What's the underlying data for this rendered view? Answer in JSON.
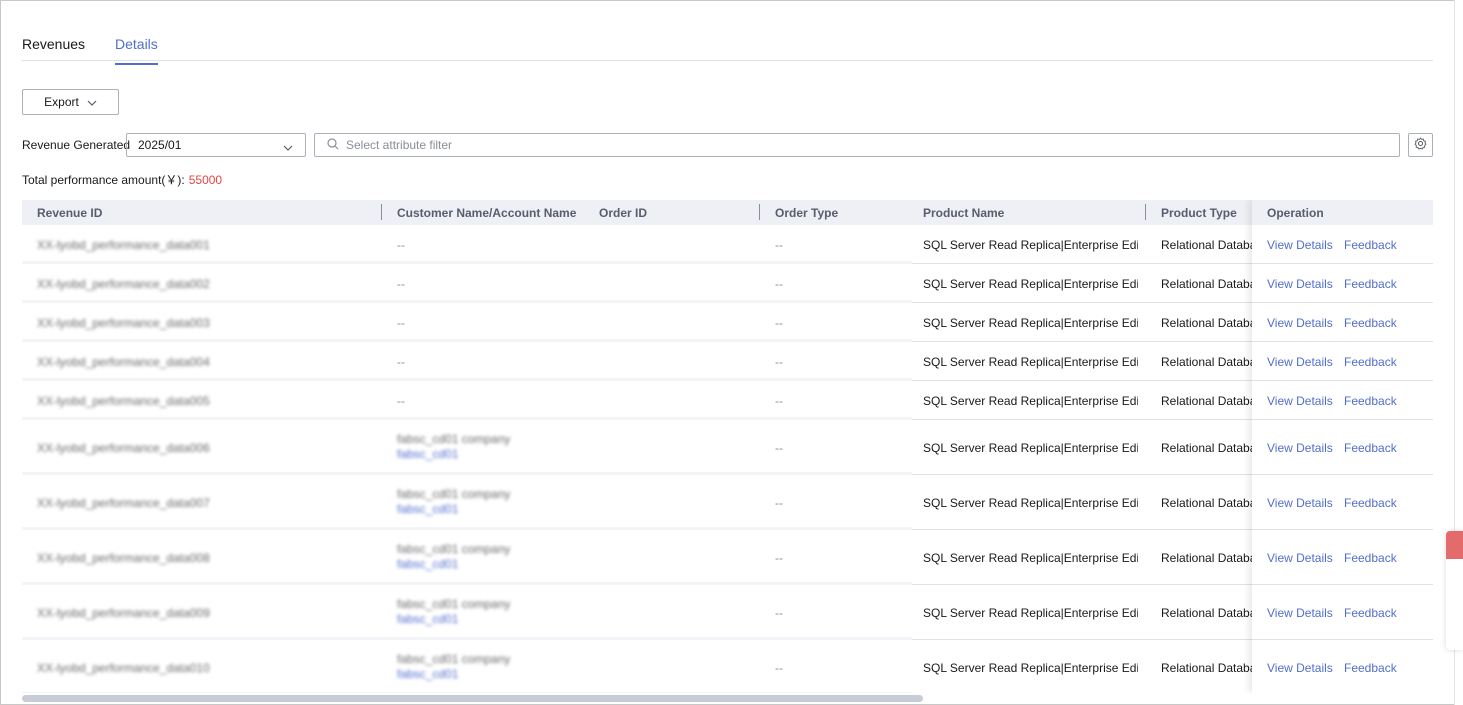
{
  "tabs": [
    {
      "label": "Revenues",
      "active": false
    },
    {
      "label": "Details",
      "active": true
    }
  ],
  "toolbar": {
    "export_label": "Export"
  },
  "filters": {
    "revenue_generated_label": "Revenue Generated",
    "month_value": "2025/01",
    "attribute_placeholder": "Select attribute filter"
  },
  "total": {
    "label": "Total performance amount(￥):",
    "amount": "55000"
  },
  "table": {
    "columns": [
      "Revenue ID",
      "Customer Name/Account Name",
      "Order ID",
      "Order Type",
      "Product Name",
      "Product Type",
      "Operation"
    ],
    "rows": [
      {
        "revenue_id": "XX-lyobd_performance_data001",
        "customer": "--",
        "account": "",
        "order_id": "",
        "order_type": "--",
        "product_name": "SQL Server Read Replica|Enterprise Edit...",
        "product_type": "Relational Databas",
        "view": "View Details",
        "feedback": "Feedback"
      },
      {
        "revenue_id": "XX-lyobd_performance_data002",
        "customer": "--",
        "account": "",
        "order_id": "",
        "order_type": "--",
        "product_name": "SQL Server Read Replica|Enterprise Edit...",
        "product_type": "Relational Databas",
        "view": "View Details",
        "feedback": "Feedback"
      },
      {
        "revenue_id": "XX-lyobd_performance_data003",
        "customer": "--",
        "account": "",
        "order_id": "",
        "order_type": "--",
        "product_name": "SQL Server Read Replica|Enterprise Edit...",
        "product_type": "Relational Databas",
        "view": "View Details",
        "feedback": "Feedback"
      },
      {
        "revenue_id": "XX-lyobd_performance_data004",
        "customer": "--",
        "account": "",
        "order_id": "",
        "order_type": "--",
        "product_name": "SQL Server Read Replica|Enterprise Edit...",
        "product_type": "Relational Databas",
        "view": "View Details",
        "feedback": "Feedback"
      },
      {
        "revenue_id": "XX-lyobd_performance_data005",
        "customer": "--",
        "account": "",
        "order_id": "",
        "order_type": "--",
        "product_name": "SQL Server Read Replica|Enterprise Edit...",
        "product_type": "Relational Databas",
        "view": "View Details",
        "feedback": "Feedback"
      },
      {
        "revenue_id": "XX-lyobd_performance_data006",
        "customer": "fabsc_cd01 company",
        "account": "fabsc_cd01",
        "order_id": "",
        "order_type": "--",
        "product_name": "SQL Server Read Replica|Enterprise Edit...",
        "product_type": "Relational Databas",
        "view": "View Details",
        "feedback": "Feedback"
      },
      {
        "revenue_id": "XX-lyobd_performance_data007",
        "customer": "fabsc_cd01 company",
        "account": "fabsc_cd01",
        "order_id": "",
        "order_type": "--",
        "product_name": "SQL Server Read Replica|Enterprise Edit...",
        "product_type": "Relational Databas",
        "view": "View Details",
        "feedback": "Feedback"
      },
      {
        "revenue_id": "XX-lyobd_performance_data008",
        "customer": "fabsc_cd01 company",
        "account": "fabsc_cd01",
        "order_id": "",
        "order_type": "--",
        "product_name": "SQL Server Read Replica|Enterprise Edit...",
        "product_type": "Relational Databas",
        "view": "View Details",
        "feedback": "Feedback"
      },
      {
        "revenue_id": "XX-lyobd_performance_data009",
        "customer": "fabsc_cd01 company",
        "account": "fabsc_cd01",
        "order_id": "",
        "order_type": "--",
        "product_name": "SQL Server Read Replica|Enterprise Edit...",
        "product_type": "Relational Databas",
        "view": "View Details",
        "feedback": "Feedback"
      },
      {
        "revenue_id": "XX-lyobd_performance_data010",
        "customer": "fabsc_cd01 company",
        "account": "fabsc_cd01",
        "order_id": "",
        "order_type": "--",
        "product_name": "SQL Server Read Replica|Enterprise Edit...",
        "product_type": "Relational Databas",
        "view": "View Details",
        "feedback": "Feedback"
      }
    ]
  },
  "colors": {
    "accent": "#526ecc",
    "amount": "#e54545",
    "header_bg": "#eef0f5"
  }
}
